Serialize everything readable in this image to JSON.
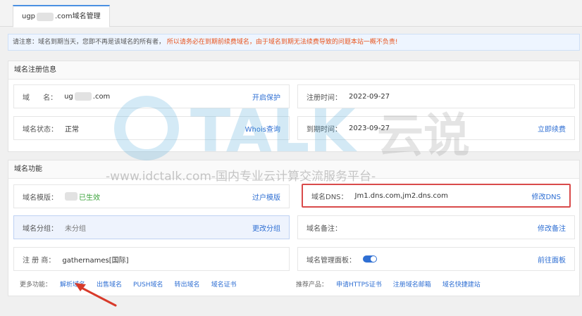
{
  "tab": {
    "prefix": "ugp",
    "suffix": ".com域名管理"
  },
  "notice": {
    "normal": "请注意：域名到期当天，您即不再是该域名的所有者，",
    "warning": "所以请务必在到期前续费域名，由于域名到期无法续费导致的问题本站一概不负责!"
  },
  "registration": {
    "title": "域名注册信息",
    "domain": {
      "label": "域      名：",
      "prefix": "ug",
      "suffix": ".com",
      "action": "开启保护"
    },
    "reg_time": {
      "label": "注册时间：",
      "value": "2022-09-27"
    },
    "status": {
      "label": "域名状态：",
      "value": "正常",
      "action": "Whois查询"
    },
    "expire": {
      "label": "到期时间：",
      "value": "2023-09-27",
      "action": "立即续费"
    }
  },
  "functions": {
    "title": "域名功能",
    "template": {
      "label": "域名模版：",
      "status": "已生效",
      "action": "过户模版"
    },
    "dns": {
      "label": "域名DNS：",
      "value": "Jm1.dns.com,jm2.dns.com",
      "action": "修改DNS"
    },
    "group": {
      "label": "域名分组：",
      "value": "未分组",
      "action": "更改分组"
    },
    "remark": {
      "label": "域名备注：",
      "action": "修改备注"
    },
    "registrar": {
      "label": "注 册 商：",
      "value": "gathernames[国际]"
    },
    "panel": {
      "label": "域名管理面板：",
      "action": "前往面板"
    },
    "more_label": "更多功能：",
    "more": [
      "解析域名",
      "出售域名",
      "PUSH域名",
      "转出域名",
      "域名证书"
    ],
    "recommend_label": "推荐产品：",
    "recommend": [
      "申请HTTPS证书",
      "注册域名邮箱",
      "域名快捷建站"
    ]
  },
  "watermark": {
    "brand": "TALK",
    "brand_cn": "云说",
    "url": "-www.idctalk.com-国内专业云计算交流服务平台-"
  }
}
